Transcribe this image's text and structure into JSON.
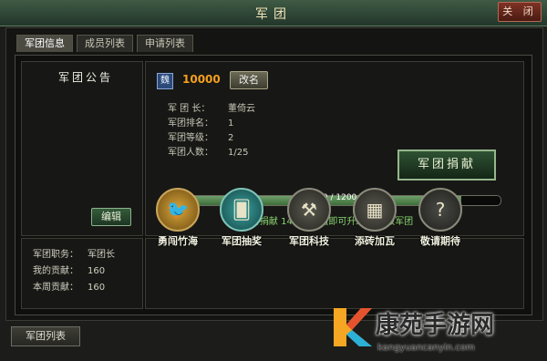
{
  "window": {
    "title": "军团",
    "close_label": "关 闭"
  },
  "tabs": [
    {
      "label": "军团信息",
      "active": true
    },
    {
      "label": "成员列表",
      "active": false
    },
    {
      "label": "申请列表",
      "active": false
    }
  ],
  "announcement": {
    "title": "军团公告",
    "edit_label": "编辑"
  },
  "legion": {
    "badge": "魏",
    "money": "10000",
    "rename_label": "改名",
    "leader_label": "军 团 长：",
    "leader_value": "董倚云",
    "rank_label": "军团排名：",
    "rank_value": "1",
    "level_label": "军团等级：",
    "level_value": "2",
    "members_label": "军团人数：",
    "members_value": "1/25",
    "donate_label": "军团捐献",
    "progress_text": "1060 / 1200",
    "progress_current": 1060,
    "progress_max": 1200,
    "hint": "再捐献 140 成长值即可升级为 3 级军团"
  },
  "player": {
    "post_label": "军团职务：",
    "post_value": "军团长",
    "contrib_label": "我的贡献：",
    "contrib_value": "160",
    "weekly_label": "本周贡献：",
    "weekly_value": "160"
  },
  "features": [
    {
      "label": "勇闯竹海",
      "icon": "bird-icon"
    },
    {
      "label": "军团抽奖",
      "icon": "cards-icon"
    },
    {
      "label": "军团科技",
      "icon": "hammer-icon"
    },
    {
      "label": "添砖加瓦",
      "icon": "bricks-icon"
    },
    {
      "label": "敬请期待",
      "icon": "question-icon"
    }
  ],
  "bottom": {
    "list_label": "军团列表"
  },
  "watermark": {
    "cn": "康苑手游网",
    "en": "kangyuancanyin.com"
  }
}
